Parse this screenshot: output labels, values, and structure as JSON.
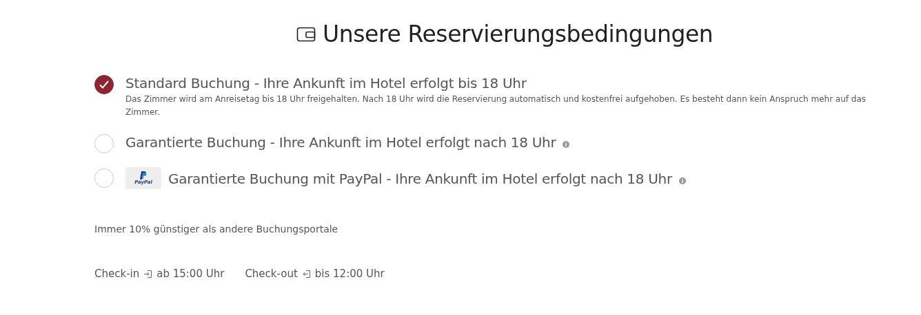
{
  "title": "Unsere Reservierungsbedingungen",
  "options": [
    {
      "label": "Standard Buchung - Ihre Ankunft im Hotel erfolgt bis 18 Uhr",
      "selected": true,
      "description": "Das Zimmer wird am Anreisetag bis 18 Uhr freigehalten. Nach 18 Uhr wird die Reservierung automatisch und kostenfrei aufgehoben. Es besteht dann kein Anspruch mehr auf das Zimmer.",
      "info": false
    },
    {
      "label": "Garantierte Buchung - Ihre Ankunft im Hotel erfolgt nach 18 Uhr",
      "selected": false,
      "info": true
    },
    {
      "label": "Garantierte Buchung mit PayPal - Ihre Ankunft im Hotel erfolgt nach 18 Uhr",
      "selected": false,
      "info": true,
      "badge": "PayPal"
    }
  ],
  "note": "Immer 10% günstiger als andere Buchungsportale",
  "times": [
    {
      "kind": "checkin",
      "label": "Check-in",
      "value": "ab 15:00 Uhr"
    },
    {
      "kind": "checkout",
      "label": "Check-out",
      "value": "bis 12:00 Uhr"
    }
  ]
}
